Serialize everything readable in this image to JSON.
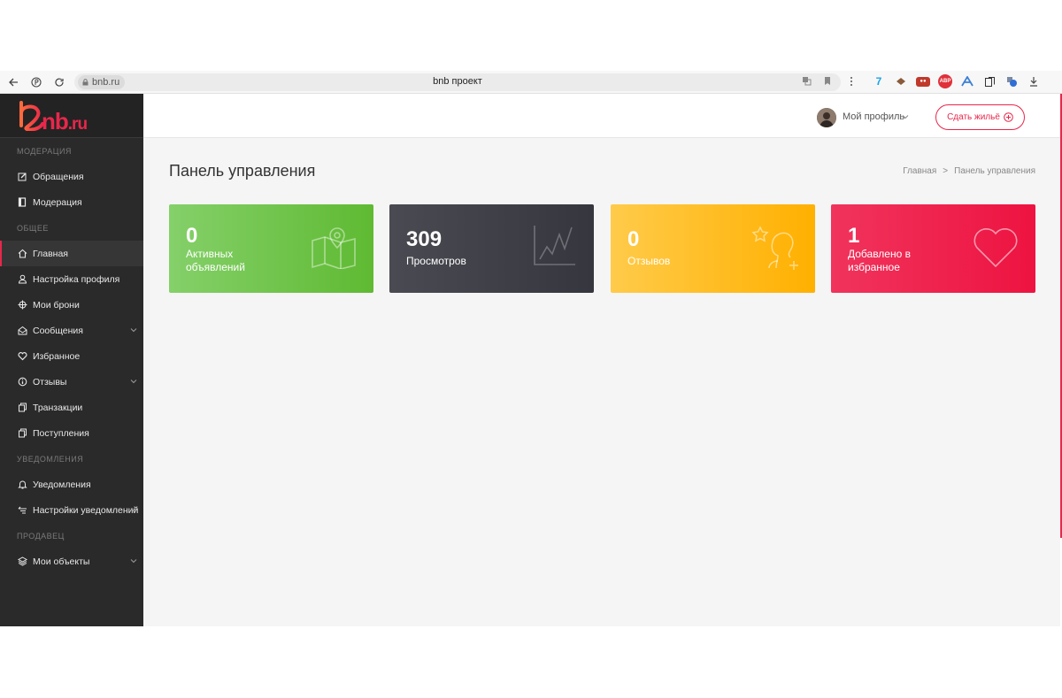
{
  "browser": {
    "domain": "bnb.ru",
    "tab_title": "bnb проект",
    "extensions": [
      {
        "name": "translate-extension",
        "label": "7",
        "color": "#1aa3e8"
      },
      {
        "name": "cookie-extension",
        "label": "",
        "color": "#8a5a3a"
      },
      {
        "name": "radio-extension",
        "label": "",
        "color": "#c0392b"
      },
      {
        "name": "adblock-plus-extension",
        "label": "ABP",
        "color": "#e0303a"
      },
      {
        "name": "feather-extension",
        "label": "",
        "color": "#3c7fd6"
      },
      {
        "name": "bookmark-extension",
        "label": "",
        "color": "#ffffff"
      },
      {
        "name": "puzzle-extension",
        "label": "",
        "color": "#2f6fd6"
      }
    ]
  },
  "brand": {
    "logo_main": "nb",
    "logo_suffix": ".ru",
    "accent": "#e8274b"
  },
  "sidebar": {
    "sections": [
      {
        "title": "МОДЕРАЦИЯ",
        "items": [
          {
            "label": "Обращения",
            "icon": "edit-icon",
            "active": false,
            "chevron": false
          },
          {
            "label": "Модерация",
            "icon": "book-icon",
            "active": false,
            "chevron": false
          }
        ]
      },
      {
        "title": "ОБЩЕЕ",
        "items": [
          {
            "label": "Главная",
            "icon": "home-icon",
            "active": true,
            "chevron": false
          },
          {
            "label": "Настройка профиля",
            "icon": "user-icon",
            "active": false,
            "chevron": false
          },
          {
            "label": "Мои брони",
            "icon": "compass-icon",
            "active": false,
            "chevron": false
          },
          {
            "label": "Сообщения",
            "icon": "envelope-icon",
            "active": false,
            "chevron": true
          },
          {
            "label": "Избранное",
            "icon": "heart-icon",
            "active": false,
            "chevron": false
          },
          {
            "label": "Отзывы",
            "icon": "info-icon",
            "active": false,
            "chevron": true
          },
          {
            "label": "Транзакции",
            "icon": "copy-icon",
            "active": false,
            "chevron": false
          },
          {
            "label": "Поступления",
            "icon": "copy-icon",
            "active": false,
            "chevron": false
          }
        ]
      },
      {
        "title": "УВЕДОМЛЕНИЯ",
        "items": [
          {
            "label": "Уведомления",
            "icon": "bell-icon",
            "active": false,
            "chevron": false
          },
          {
            "label": "Настройки уведомлений",
            "icon": "megaphone-icon",
            "active": false,
            "chevron": true
          }
        ]
      },
      {
        "title": "ПРОДАВЕЦ",
        "items": [
          {
            "label": "Мои объекты",
            "icon": "layers-icon",
            "active": false,
            "chevron": true
          }
        ]
      }
    ]
  },
  "header": {
    "profile_label": "Мой профиль",
    "rent_button": "Сдать жильё"
  },
  "main": {
    "title": "Панель управления",
    "breadcrumb": [
      "Главная",
      ">",
      "Панель управления"
    ],
    "cards": [
      {
        "value": "0",
        "label": "Активных объявлений",
        "icon": "map-pin-icon",
        "color": "#6cc241"
      },
      {
        "value": "309",
        "label": "Просмотров",
        "icon": "line-chart-icon",
        "color": "#3c3d45"
      },
      {
        "value": "0",
        "label": "Отзывов",
        "icon": "user-star-icon",
        "color": "#ffbb1e"
      },
      {
        "value": "1",
        "label": "Добавлено в избранное",
        "icon": "heart-outline-icon",
        "color": "#ef2049"
      }
    ]
  }
}
